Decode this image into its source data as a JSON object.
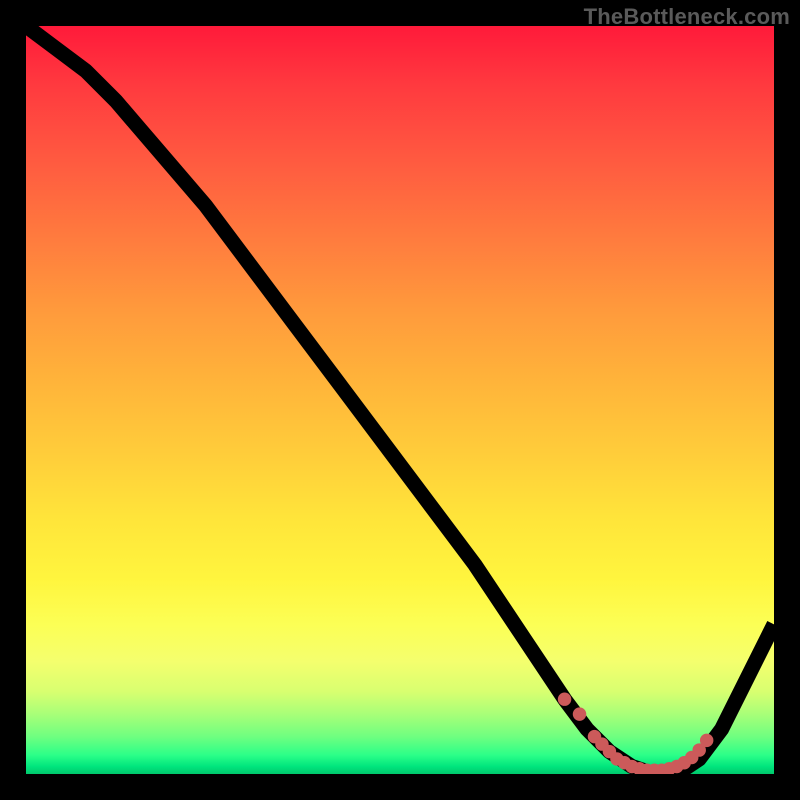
{
  "watermark": "TheBottleneck.com",
  "chart_data": {
    "type": "line",
    "title": "",
    "xlabel": "",
    "ylabel": "",
    "xlim": [
      0,
      100
    ],
    "ylim": [
      0,
      100
    ],
    "grid": false,
    "legend": false,
    "series": [
      {
        "name": "curve",
        "x": [
          0,
          4,
          8,
          12,
          18,
          24,
          30,
          36,
          42,
          48,
          54,
          60,
          64,
          68,
          72,
          75,
          78,
          81,
          84,
          87,
          90,
          93,
          96,
          100
        ],
        "y": [
          100,
          97,
          94,
          90,
          83,
          76,
          68,
          60,
          52,
          44,
          36,
          28,
          22,
          16,
          10,
          6,
          3,
          1,
          0,
          0,
          2,
          6,
          12,
          20
        ]
      }
    ],
    "highlight_dots": {
      "name": "bottleneck-zone",
      "x": [
        72,
        74,
        76,
        77,
        78,
        79,
        80,
        81,
        82,
        83,
        84,
        85,
        86,
        87,
        88,
        89,
        90,
        91
      ],
      "y": [
        10,
        8,
        5,
        4,
        3,
        2,
        1.5,
        1,
        0.7,
        0.5,
        0.5,
        0.5,
        0.7,
        1,
        1.5,
        2.2,
        3.2,
        4.5
      ]
    },
    "gradient_stops": [
      {
        "pos": 0,
        "color": "#ff1a3a"
      },
      {
        "pos": 50,
        "color": "#ffb53a"
      },
      {
        "pos": 75,
        "color": "#fff53e"
      },
      {
        "pos": 100,
        "color": "#00c86c"
      }
    ]
  }
}
